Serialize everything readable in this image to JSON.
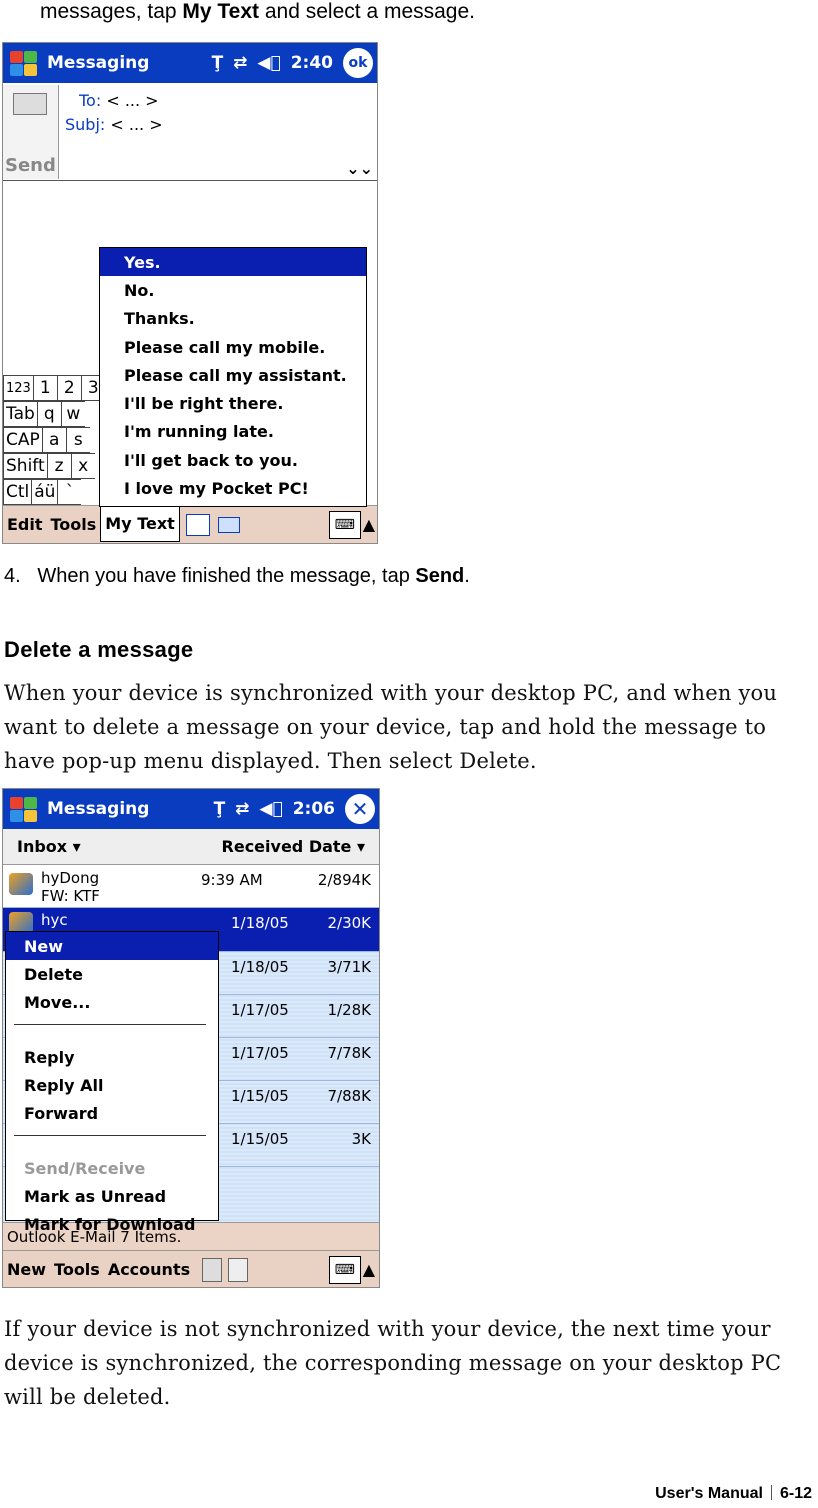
{
  "intro": {
    "pre": "messages, tap ",
    "bold": "My Text",
    "post": " and select a message."
  },
  "shot1": {
    "title": "Messaging",
    "time": "2:40",
    "ok": "ok",
    "send_label": "Send",
    "to_label": "To:",
    "to_value": "< ... >",
    "subj_label": "Subj:",
    "subj_value": "< ... >",
    "keyboard": {
      "row1": [
        "123",
        "1",
        "2",
        "3"
      ],
      "row2": [
        "Tab",
        "q",
        "w"
      ],
      "row3": [
        "CAP",
        "a",
        "s"
      ],
      "row4": [
        "Shift",
        "z",
        "x"
      ],
      "row5": [
        "Ctl",
        "áü",
        "`"
      ]
    },
    "mytext_items": [
      "Yes.",
      "No.",
      "Thanks.",
      "Please call my mobile.",
      "Please call my assistant.",
      "I'll be right there.",
      "I'm running late.",
      "I'll get back to you.",
      "I love my Pocket PC!"
    ],
    "menu": {
      "edit": "Edit",
      "tools": "Tools",
      "mytext": "My Text"
    }
  },
  "step4": {
    "num": "4.",
    "pre": "When you have finished the message, tap ",
    "bold": "Send",
    "post": "."
  },
  "heading": "Delete a message",
  "para1": "When your device is synchronized with your desktop PC, and when you want to delete a message on your device, tap and hold the message to have pop-up menu displayed. Then select Delete.",
  "shot2": {
    "title": "Messaging",
    "time": "2:06",
    "folder": "Inbox ▾",
    "sort": "Received Date ▾",
    "rows": [
      {
        "from": "hyDong",
        "sub": "FW: KTF",
        "date": "9:39 AM",
        "size": "2/894K"
      },
      {
        "from": "hyc",
        "sub": "",
        "date": "1/18/05",
        "size": "2/30K"
      },
      {
        "from": "",
        "sub": "",
        "date": "1/18/05",
        "size": "3/71K"
      },
      {
        "from": "",
        "sub": "",
        "date": "1/17/05",
        "size": "1/28K"
      },
      {
        "from": "",
        "sub": "",
        "date": "1/17/05",
        "size": "7/78K"
      },
      {
        "from": "",
        "sub": "",
        "date": "1/15/05",
        "size": "7/88K"
      },
      {
        "from": "",
        "sub": "",
        "date": "1/15/05",
        "size": "3K"
      }
    ],
    "context_menu": {
      "group1": [
        "New",
        "Delete",
        "Move..."
      ],
      "group2": [
        "Reply",
        "Reply All",
        "Forward"
      ],
      "group3": [
        "Send/Receive",
        "Mark as Unread",
        "Mark for Download"
      ]
    },
    "status": "Outlook E-Mail  7 Items.",
    "menu": {
      "new": "New",
      "tools": "Tools",
      "accounts": "Accounts"
    }
  },
  "para2": "If your device is not synchronized with your device, the next time your device is synchronized, the corresponding message on your desktop PC will be deleted.",
  "footer": {
    "manual": "User's Manual",
    "page": "6-12"
  }
}
